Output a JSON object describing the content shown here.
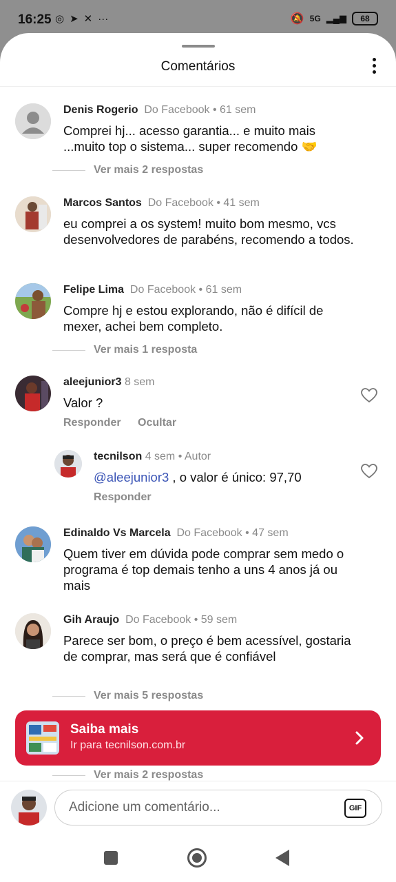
{
  "status_bar": {
    "time": "16:25",
    "battery": "68",
    "network": "5G"
  },
  "sheet": {
    "title": "Comentários"
  },
  "comments": [
    {
      "author": "Denis Rogerio",
      "source": "Do Facebook",
      "time": "61 sem",
      "text": "Comprei hj... acesso garantia... e muito mais ...muito top o sistema... super recomendo 🤝",
      "view_replies": "Ver mais 2 respostas"
    },
    {
      "author": "Marcos Santos",
      "source": "Do Facebook",
      "time": "41 sem",
      "text": "eu comprei a os system! muito bom mesmo, vcs desenvolvedores  de parabéns, recomendo a todos."
    },
    {
      "author": "Felipe Lima",
      "source": "Do Facebook",
      "time": "61 sem",
      "text": "Compre hj e estou explorando, não é difícil de mexer, achei bem completo.",
      "view_replies": "Ver mais 1 resposta"
    },
    {
      "author": "aleejunior3",
      "time": "8 sem",
      "text": "Valor ?",
      "reply_label": "Responder",
      "hide_label": "Ocultar",
      "reply": {
        "author": "tecnilson",
        "time": "4 sem",
        "badge": "Autor",
        "mention": "@aleejunior3",
        "text": " , o valor é único: 97,70",
        "reply_label": "Responder"
      }
    },
    {
      "author": "Edinaldo Vs Marcela",
      "source": "Do Facebook",
      "time": "47 sem",
      "text": "Quem tiver em dúvida pode comprar sem medo o programa é top demais tenho a uns 4 anos já ou mais"
    },
    {
      "author": "Gih Araujo",
      "source": "Do Facebook",
      "time": "59 sem",
      "text": "Parece ser bom, o preço é bem acessível, gostaria de comprar, mas será que é confiável",
      "view_replies": "Ver mais 5 respostas"
    }
  ],
  "extra_replies": "Ver mais 2 respostas",
  "promo": {
    "title": "Saiba mais",
    "subtitle": "Ir para tecnilson.com.br"
  },
  "composer": {
    "placeholder": "Adicione um comentário...",
    "gif_label": "GIF"
  },
  "colors": {
    "promo_bg": "#d91f3c",
    "mention": "#3b55b6",
    "muted_text": "#8a8a8a"
  }
}
